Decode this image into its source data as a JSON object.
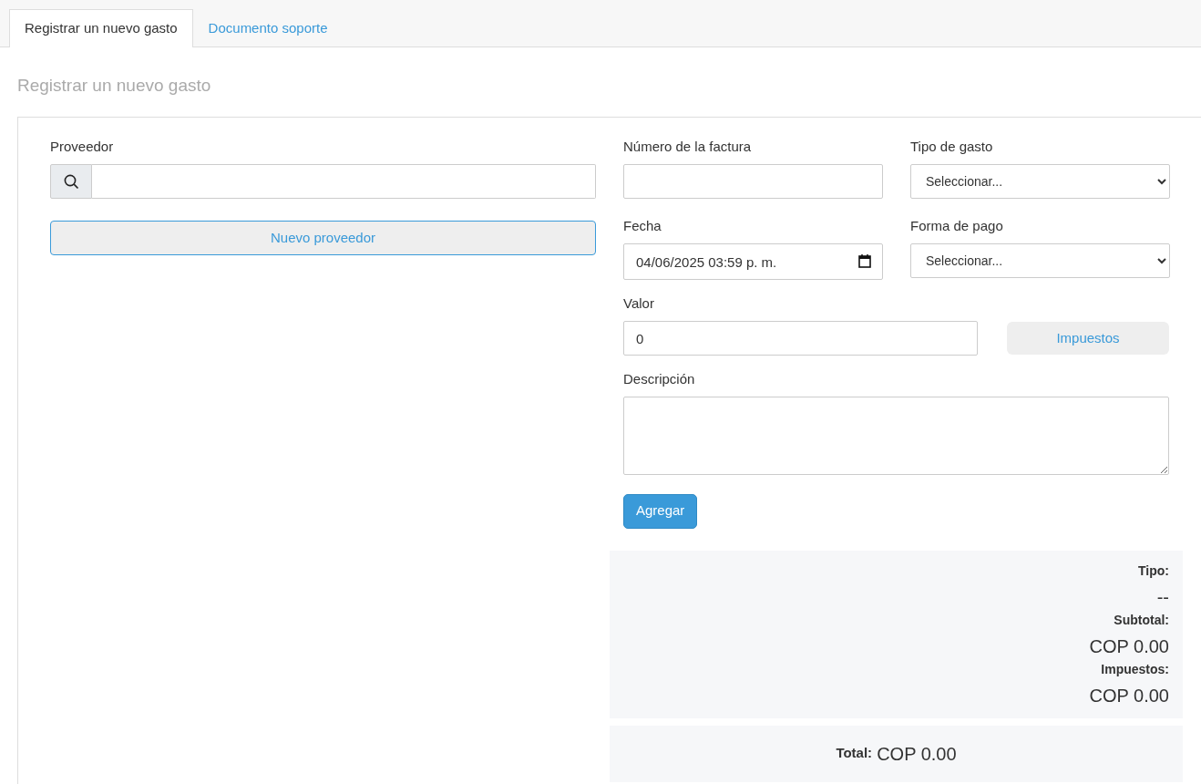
{
  "tabs": [
    {
      "label": "Registrar un nuevo gasto",
      "selected": true
    },
    {
      "label": "Documento soporte",
      "selected": false
    }
  ],
  "heading": "Registrar un nuevo gasto",
  "supplier": {
    "label": "Proveedor",
    "new_button": "Nuevo proveedor"
  },
  "form": {
    "invoice_number": {
      "label": "Número de la factura"
    },
    "expense_type": {
      "label": "Tipo de gasto",
      "value": "Seleccionar..."
    },
    "date": {
      "label": "Fecha",
      "value": "04/06/2025 03:59 p. m."
    },
    "payment_method": {
      "label": "Forma de pago",
      "value": "Seleccionar..."
    },
    "amount": {
      "label": "Valor",
      "value": "0"
    },
    "taxes_button": "Impuestos",
    "description": {
      "label": "Descripción"
    },
    "add_button": "Agregar"
  },
  "summary": {
    "items": [
      {
        "label": "Tipo:",
        "value": "--"
      },
      {
        "label": "Subtotal:",
        "value": "COP 0.00"
      },
      {
        "label": "Impuestos:",
        "value": "COP 0.00"
      }
    ],
    "total": {
      "label": "Total:",
      "value": "COP 0.00"
    }
  }
}
